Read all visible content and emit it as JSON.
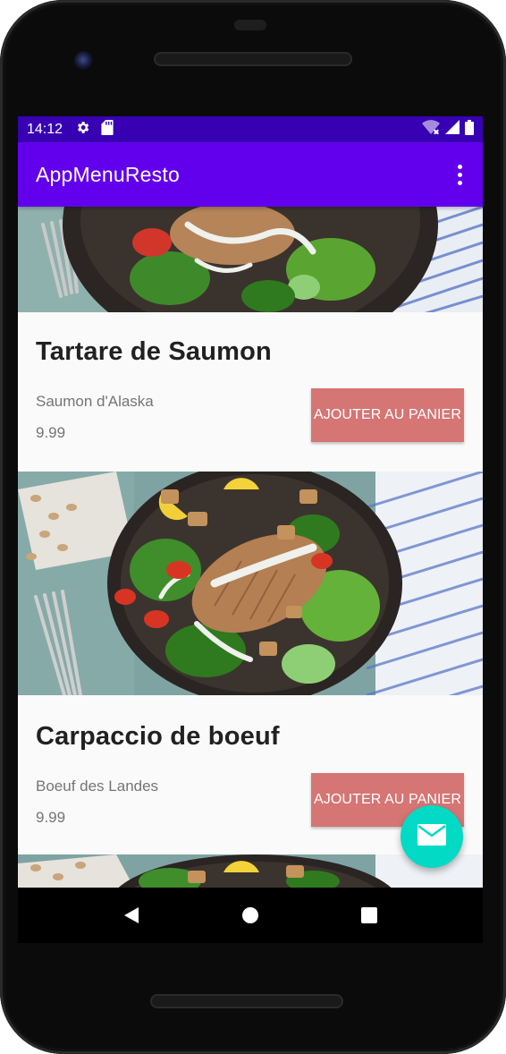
{
  "status_bar": {
    "time": "14:12",
    "left_icons": [
      "settings-icon",
      "sd-card-icon"
    ],
    "right_icons": [
      "wifi-icon",
      "cell-signal-icon",
      "battery-icon"
    ]
  },
  "app_bar": {
    "title": "AppMenuResto",
    "overflow_icon": "more-vert-icon",
    "color": "#6200ee",
    "status_color": "#3700b3"
  },
  "menu_items": [
    {
      "name": "Tartare de Saumon",
      "description": "Saumon d'Alaska",
      "price": "9.99",
      "button_label": "AJOUTER AU PANIER"
    },
    {
      "name": "Carpaccio de boeuf",
      "description": "Boeuf des Landes",
      "price": "9.99",
      "button_label": "AJOUTER AU PANIER"
    }
  ],
  "button_color": "#d57574",
  "fab": {
    "icon": "mail-icon",
    "color": "#03dac5"
  },
  "nav_bar": {
    "icons": [
      "back-icon",
      "home-icon",
      "recents-icon"
    ]
  }
}
